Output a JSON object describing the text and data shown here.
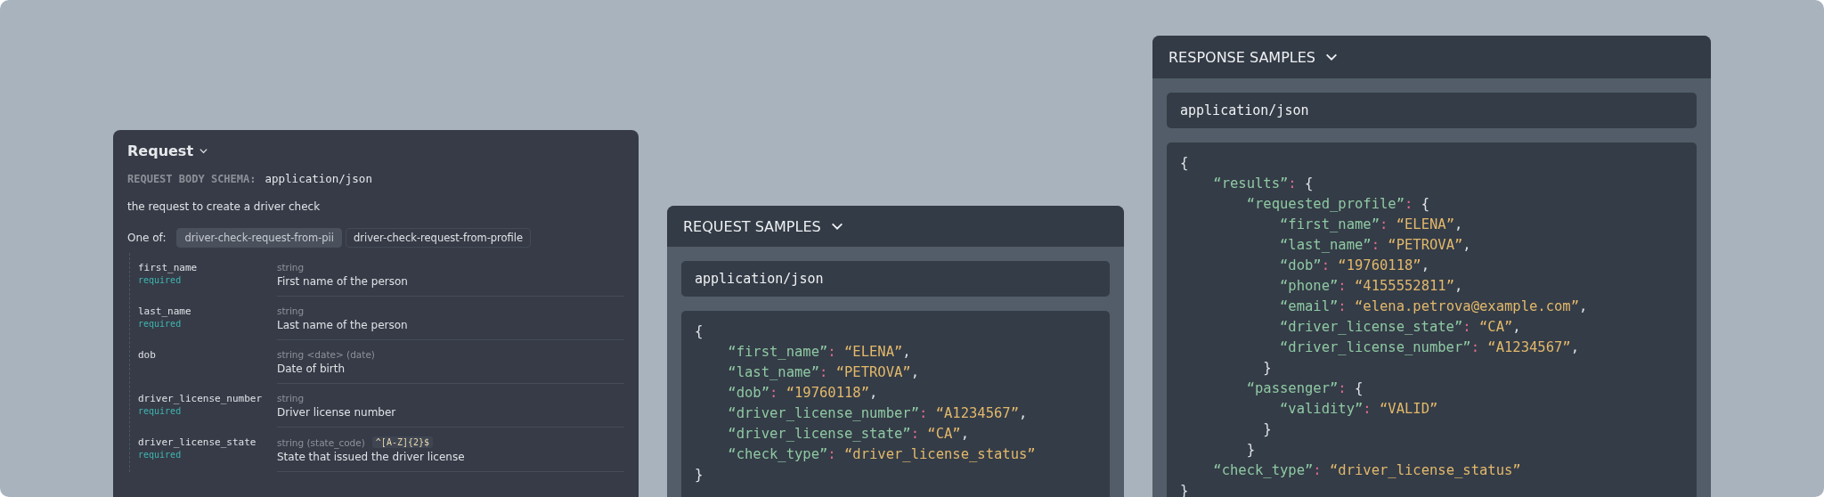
{
  "request_panel": {
    "title": "Request",
    "schema_label": "REQUEST BODY SCHEMA:",
    "schema_type": "application/json",
    "description": "the request to create a driver check",
    "one_of_label": "One of:",
    "one_of_options": [
      {
        "label": "driver-check-request-from-pii",
        "selected": true
      },
      {
        "label": "driver-check-request-from-profile",
        "selected": false
      }
    ],
    "fields": [
      {
        "name": "first_name",
        "required": "required",
        "type": "string",
        "description": "First name of the person"
      },
      {
        "name": "last_name",
        "required": "required",
        "type": "string",
        "description": "Last name of the person"
      },
      {
        "name": "dob",
        "type": "string <date> (date)",
        "description": "Date of birth"
      },
      {
        "name": "driver_license_number",
        "required": "required",
        "type": "string",
        "description": "Driver license number"
      },
      {
        "name": "driver_license_state",
        "required": "required",
        "type": "string (state_code)",
        "pattern": "^[A-Z]{2}$",
        "description": "State that issued the driver license"
      }
    ]
  },
  "request_samples": {
    "title": "REQUEST SAMPLES",
    "content_type": "application/json",
    "code": [
      "{",
      "    “first_name”: “ELENA”,",
      "    “last_name”: “PETROVA”,",
      "    “dob”: “19760118”,",
      "    “driver_license_number”: “A1234567”,",
      "    “driver_license_state”: “CA”,",
      "    “check_type”: “driver_license_status”",
      "}"
    ]
  },
  "response_samples": {
    "title": "RESPONSE SAMPLES",
    "content_type": "application/json",
    "code": [
      "{",
      "    “results”: {",
      "        “requested_profile”: {",
      "            “first_name”: “ELENA”,",
      "            “last_name”: “PETROVA”,",
      "            “dob”: “19760118”,",
      "            “phone”: “4155552811”,",
      "            “email”: “elena.petrova@example.com”,",
      "            “driver_license_state”: “CA”,",
      "            “driver_license_number”: “A1234567”,",
      "          }",
      "        “passenger”: {",
      "            “validity”: “VALID”",
      "          }",
      "        }",
      "    “check_type”: “driver_license_status”",
      "}"
    ]
  }
}
